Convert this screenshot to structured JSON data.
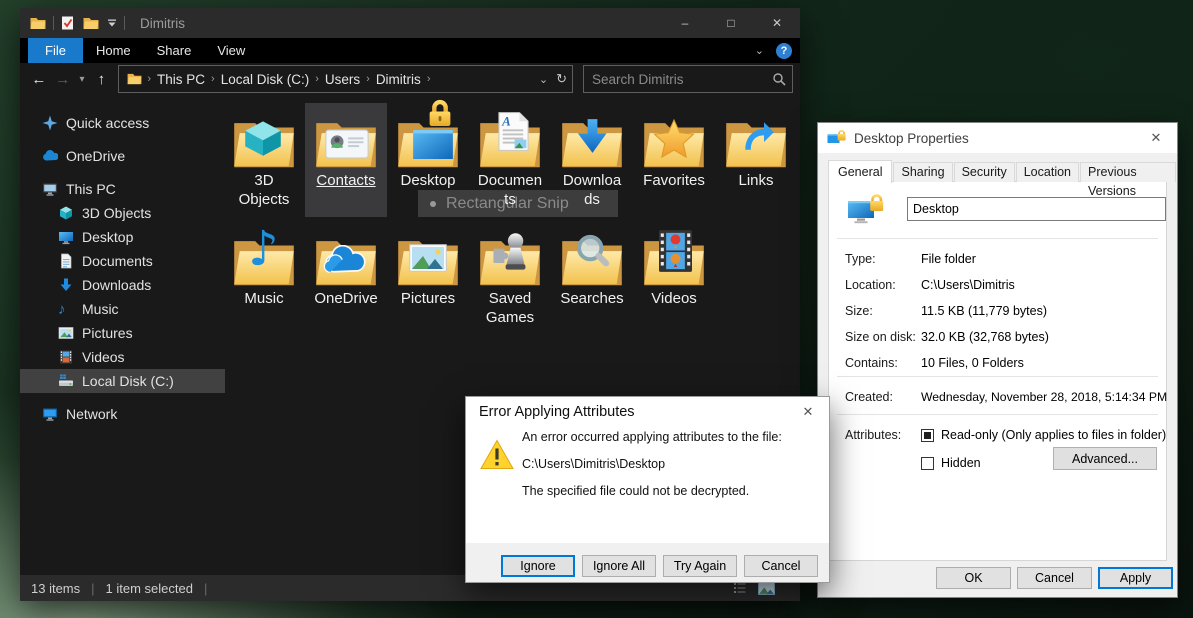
{
  "colors": {
    "file_tab_blue": "#1979ca",
    "focus_blue": "#0078d7",
    "folder_yellow": "#f4c654",
    "selection_gray": "#3a3a3d"
  },
  "explorer": {
    "title": "Dimitris",
    "ribbon_tabs": [
      {
        "label": "File",
        "active": true
      },
      {
        "label": "Home",
        "active": false
      },
      {
        "label": "Share",
        "active": false
      },
      {
        "label": "View",
        "active": false
      }
    ],
    "address": {
      "breadcrumb": [
        "This PC",
        "Local Disk (C:)",
        "Users",
        "Dimitris"
      ],
      "search_placeholder": "Search Dimitris"
    },
    "sidebar": [
      {
        "label": "Quick access",
        "icon": "star",
        "level": 0,
        "gap": false,
        "selected": false
      },
      {
        "label": "OneDrive",
        "icon": "cloud",
        "level": 0,
        "gap": true,
        "selected": false
      },
      {
        "label": "This PC",
        "icon": "monitor",
        "level": 0,
        "gap": true,
        "selected": false
      },
      {
        "label": "3D Objects",
        "icon": "cube",
        "level": 1,
        "gap": false,
        "selected": false
      },
      {
        "label": "Desktop",
        "icon": "desktop",
        "level": 1,
        "gap": false,
        "selected": false
      },
      {
        "label": "Documents",
        "icon": "document",
        "level": 1,
        "gap": false,
        "selected": false
      },
      {
        "label": "Downloads",
        "icon": "download",
        "level": 1,
        "gap": false,
        "selected": false
      },
      {
        "label": "Music",
        "icon": "music",
        "level": 1,
        "gap": false,
        "selected": false
      },
      {
        "label": "Pictures",
        "icon": "picture",
        "level": 1,
        "gap": false,
        "selected": false
      },
      {
        "label": "Videos",
        "icon": "film",
        "level": 1,
        "gap": false,
        "selected": false
      },
      {
        "label": "Local Disk (C:)",
        "icon": "drive",
        "level": 1,
        "gap": false,
        "selected": true
      },
      {
        "label": "Network",
        "icon": "network",
        "level": 0,
        "gap": true,
        "selected": false
      }
    ],
    "folders": [
      {
        "label": "3D Objects",
        "wrap": [
          "3D",
          "Objects"
        ],
        "overlay": "cube",
        "selected": false
      },
      {
        "label": "Contacts",
        "overlay": "contact",
        "selected": true
      },
      {
        "label": "Desktop",
        "overlay": "desktop_lock",
        "selected": false
      },
      {
        "label": "Documents",
        "wrap": [
          "Documen",
          "ts"
        ],
        "overlay": "document",
        "selected": false
      },
      {
        "label": "Downloads",
        "wrap": [
          "Downloa",
          "ds"
        ],
        "overlay": "download",
        "selected": false
      },
      {
        "label": "Favorites",
        "overlay": "star",
        "selected": false
      },
      {
        "label": "Links",
        "overlay": "link",
        "selected": false
      },
      {
        "label": "Music",
        "overlay": "music",
        "selected": false
      },
      {
        "label": "OneDrive",
        "overlay": "cloud",
        "selected": false
      },
      {
        "label": "Pictures",
        "overlay": "picture",
        "selected": false
      },
      {
        "label": "Saved Games",
        "wrap": [
          "Saved",
          "Games"
        ],
        "overlay": "pawn",
        "selected": false
      },
      {
        "label": "Searches",
        "overlay": "magnifier",
        "selected": false
      },
      {
        "label": "Videos",
        "overlay": "film",
        "selected": false
      }
    ],
    "ghost_overlay_text": "Rectangular Snip",
    "status": {
      "count": "13 items",
      "selected": "1 item selected"
    }
  },
  "properties_dialog": {
    "title": "Desktop Properties",
    "tabs": [
      "General",
      "Sharing",
      "Security",
      "Location",
      "Previous Versions"
    ],
    "active_tab": "General",
    "name_value": "Desktop",
    "rows": [
      {
        "label": "Type:",
        "value": "File folder"
      },
      {
        "label": "Location:",
        "value": "C:\\Users\\Dimitris"
      },
      {
        "label": "Size:",
        "value": "11.5 KB (11,779 bytes)"
      },
      {
        "label": "Size on disk:",
        "value": "32.0 KB (32,768 bytes)"
      },
      {
        "label": "Contains:",
        "value": "10 Files, 0 Folders"
      }
    ],
    "created_label": "Created:",
    "created_value": "Wednesday, November 28, 2018, 5:14:34 PM",
    "attributes_label": "Attributes:",
    "readonly_label": "Read-only (Only applies to files in folder)",
    "readonly_state": "mixed",
    "hidden_label": "Hidden",
    "hidden_state": "unchecked",
    "advanced_button": "Advanced...",
    "buttons": [
      {
        "label": "OK",
        "focused": false
      },
      {
        "label": "Cancel",
        "focused": false
      },
      {
        "label": "Apply",
        "focused": true
      }
    ]
  },
  "error_dialog": {
    "title": "Error Applying Attributes",
    "line1": "An error occurred applying attributes to the file:",
    "line2": "C:\\Users\\Dimitris\\Desktop",
    "line3": "The specified file could not be decrypted.",
    "buttons": [
      "Ignore",
      "Ignore All",
      "Try Again",
      "Cancel"
    ],
    "default_button": "Ignore"
  }
}
